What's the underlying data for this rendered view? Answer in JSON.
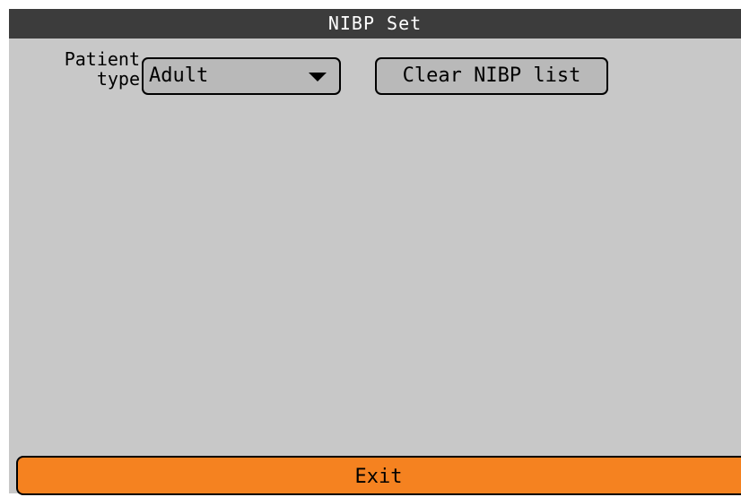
{
  "window": {
    "title": "NIBP Set"
  },
  "form": {
    "patient_type_label_line1": "Patient",
    "patient_type_label_line2": "type",
    "patient_type_value": "Adult",
    "clear_button_label": "Clear NIBP list"
  },
  "footer": {
    "exit_label": "Exit"
  },
  "colors": {
    "title_bar": "#3c3c3c",
    "panel": "#c8c8c8",
    "control": "#b9b9b9",
    "exit_button": "#f58220"
  },
  "icons": {
    "dropdown": "triangle-down-icon"
  }
}
